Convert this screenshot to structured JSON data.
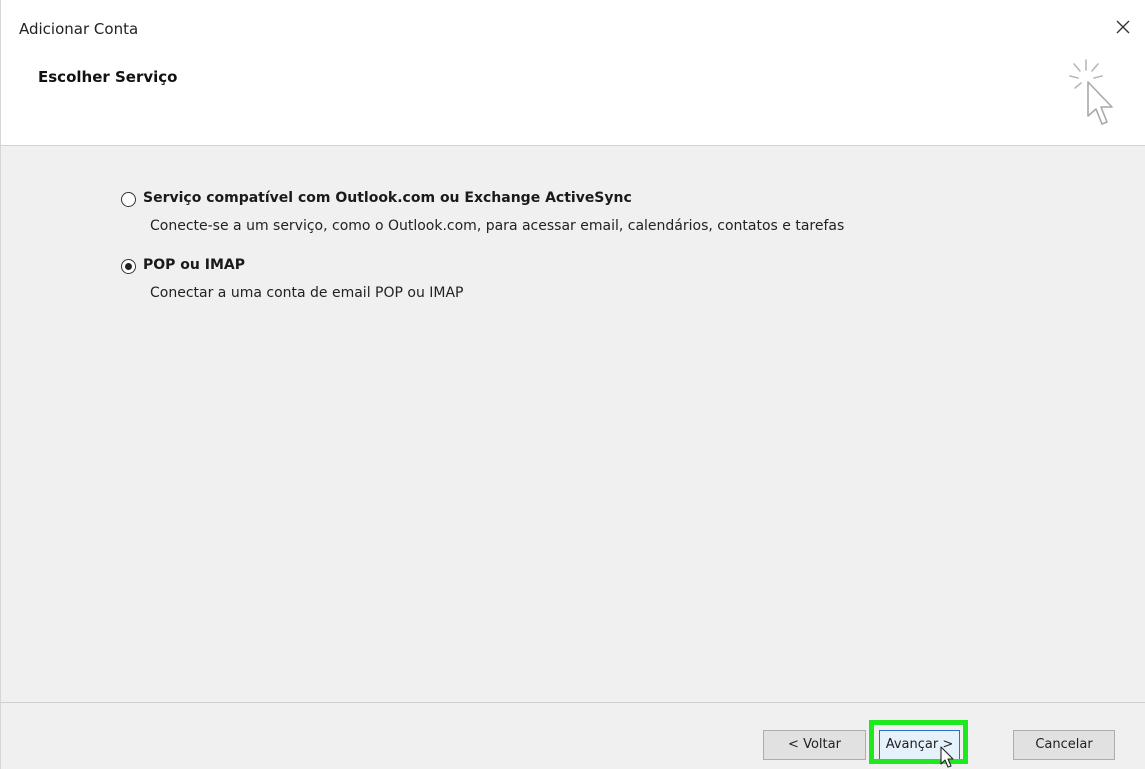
{
  "window": {
    "title": "Adicionar Conta",
    "close_icon": "close-icon"
  },
  "header": {
    "heading": "Escolher Serviço",
    "icon": "wizard-cursor-icon"
  },
  "options": [
    {
      "label": "Serviço compatível com Outlook.com ou Exchange ActiveSync",
      "description": "Conecte-se a um serviço, como o Outlook.com, para acessar email, calendários, contatos e tarefas",
      "selected": false
    },
    {
      "label": "POP ou IMAP",
      "description": "Conectar a uma conta de email POP ou IMAP",
      "selected": true
    }
  ],
  "footer": {
    "back_label": "< Voltar",
    "next_label": "Avançar >",
    "cancel_label": "Cancelar",
    "highlight_color": "#1ee81e"
  }
}
